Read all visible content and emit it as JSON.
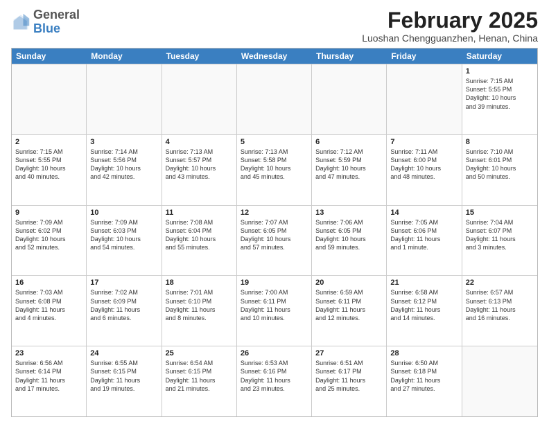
{
  "header": {
    "logo": {
      "general": "General",
      "blue": "Blue"
    },
    "title": "February 2025",
    "location": "Luoshan Chengguanzhen, Henan, China"
  },
  "weekdays": [
    "Sunday",
    "Monday",
    "Tuesday",
    "Wednesday",
    "Thursday",
    "Friday",
    "Saturday"
  ],
  "rows": [
    [
      {
        "day": "",
        "info": "",
        "empty": true
      },
      {
        "day": "",
        "info": "",
        "empty": true
      },
      {
        "day": "",
        "info": "",
        "empty": true
      },
      {
        "day": "",
        "info": "",
        "empty": true
      },
      {
        "day": "",
        "info": "",
        "empty": true
      },
      {
        "day": "",
        "info": "",
        "empty": true
      },
      {
        "day": "1",
        "info": "Sunrise: 7:15 AM\nSunset: 5:55 PM\nDaylight: 10 hours\nand 39 minutes."
      }
    ],
    [
      {
        "day": "2",
        "info": "Sunrise: 7:15 AM\nSunset: 5:55 PM\nDaylight: 10 hours\nand 40 minutes."
      },
      {
        "day": "3",
        "info": "Sunrise: 7:14 AM\nSunset: 5:56 PM\nDaylight: 10 hours\nand 42 minutes."
      },
      {
        "day": "4",
        "info": "Sunrise: 7:13 AM\nSunset: 5:57 PM\nDaylight: 10 hours\nand 43 minutes."
      },
      {
        "day": "5",
        "info": "Sunrise: 7:13 AM\nSunset: 5:58 PM\nDaylight: 10 hours\nand 45 minutes."
      },
      {
        "day": "6",
        "info": "Sunrise: 7:12 AM\nSunset: 5:59 PM\nDaylight: 10 hours\nand 47 minutes."
      },
      {
        "day": "7",
        "info": "Sunrise: 7:11 AM\nSunset: 6:00 PM\nDaylight: 10 hours\nand 48 minutes."
      },
      {
        "day": "8",
        "info": "Sunrise: 7:10 AM\nSunset: 6:01 PM\nDaylight: 10 hours\nand 50 minutes."
      }
    ],
    [
      {
        "day": "9",
        "info": "Sunrise: 7:09 AM\nSunset: 6:02 PM\nDaylight: 10 hours\nand 52 minutes."
      },
      {
        "day": "10",
        "info": "Sunrise: 7:09 AM\nSunset: 6:03 PM\nDaylight: 10 hours\nand 54 minutes."
      },
      {
        "day": "11",
        "info": "Sunrise: 7:08 AM\nSunset: 6:04 PM\nDaylight: 10 hours\nand 55 minutes."
      },
      {
        "day": "12",
        "info": "Sunrise: 7:07 AM\nSunset: 6:05 PM\nDaylight: 10 hours\nand 57 minutes."
      },
      {
        "day": "13",
        "info": "Sunrise: 7:06 AM\nSunset: 6:05 PM\nDaylight: 10 hours\nand 59 minutes."
      },
      {
        "day": "14",
        "info": "Sunrise: 7:05 AM\nSunset: 6:06 PM\nDaylight: 11 hours\nand 1 minute."
      },
      {
        "day": "15",
        "info": "Sunrise: 7:04 AM\nSunset: 6:07 PM\nDaylight: 11 hours\nand 3 minutes."
      }
    ],
    [
      {
        "day": "16",
        "info": "Sunrise: 7:03 AM\nSunset: 6:08 PM\nDaylight: 11 hours\nand 4 minutes."
      },
      {
        "day": "17",
        "info": "Sunrise: 7:02 AM\nSunset: 6:09 PM\nDaylight: 11 hours\nand 6 minutes."
      },
      {
        "day": "18",
        "info": "Sunrise: 7:01 AM\nSunset: 6:10 PM\nDaylight: 11 hours\nand 8 minutes."
      },
      {
        "day": "19",
        "info": "Sunrise: 7:00 AM\nSunset: 6:11 PM\nDaylight: 11 hours\nand 10 minutes."
      },
      {
        "day": "20",
        "info": "Sunrise: 6:59 AM\nSunset: 6:11 PM\nDaylight: 11 hours\nand 12 minutes."
      },
      {
        "day": "21",
        "info": "Sunrise: 6:58 AM\nSunset: 6:12 PM\nDaylight: 11 hours\nand 14 minutes."
      },
      {
        "day": "22",
        "info": "Sunrise: 6:57 AM\nSunset: 6:13 PM\nDaylight: 11 hours\nand 16 minutes."
      }
    ],
    [
      {
        "day": "23",
        "info": "Sunrise: 6:56 AM\nSunset: 6:14 PM\nDaylight: 11 hours\nand 17 minutes."
      },
      {
        "day": "24",
        "info": "Sunrise: 6:55 AM\nSunset: 6:15 PM\nDaylight: 11 hours\nand 19 minutes."
      },
      {
        "day": "25",
        "info": "Sunrise: 6:54 AM\nSunset: 6:15 PM\nDaylight: 11 hours\nand 21 minutes."
      },
      {
        "day": "26",
        "info": "Sunrise: 6:53 AM\nSunset: 6:16 PM\nDaylight: 11 hours\nand 23 minutes."
      },
      {
        "day": "27",
        "info": "Sunrise: 6:51 AM\nSunset: 6:17 PM\nDaylight: 11 hours\nand 25 minutes."
      },
      {
        "day": "28",
        "info": "Sunrise: 6:50 AM\nSunset: 6:18 PM\nDaylight: 11 hours\nand 27 minutes."
      },
      {
        "day": "",
        "info": "",
        "empty": true
      }
    ]
  ]
}
